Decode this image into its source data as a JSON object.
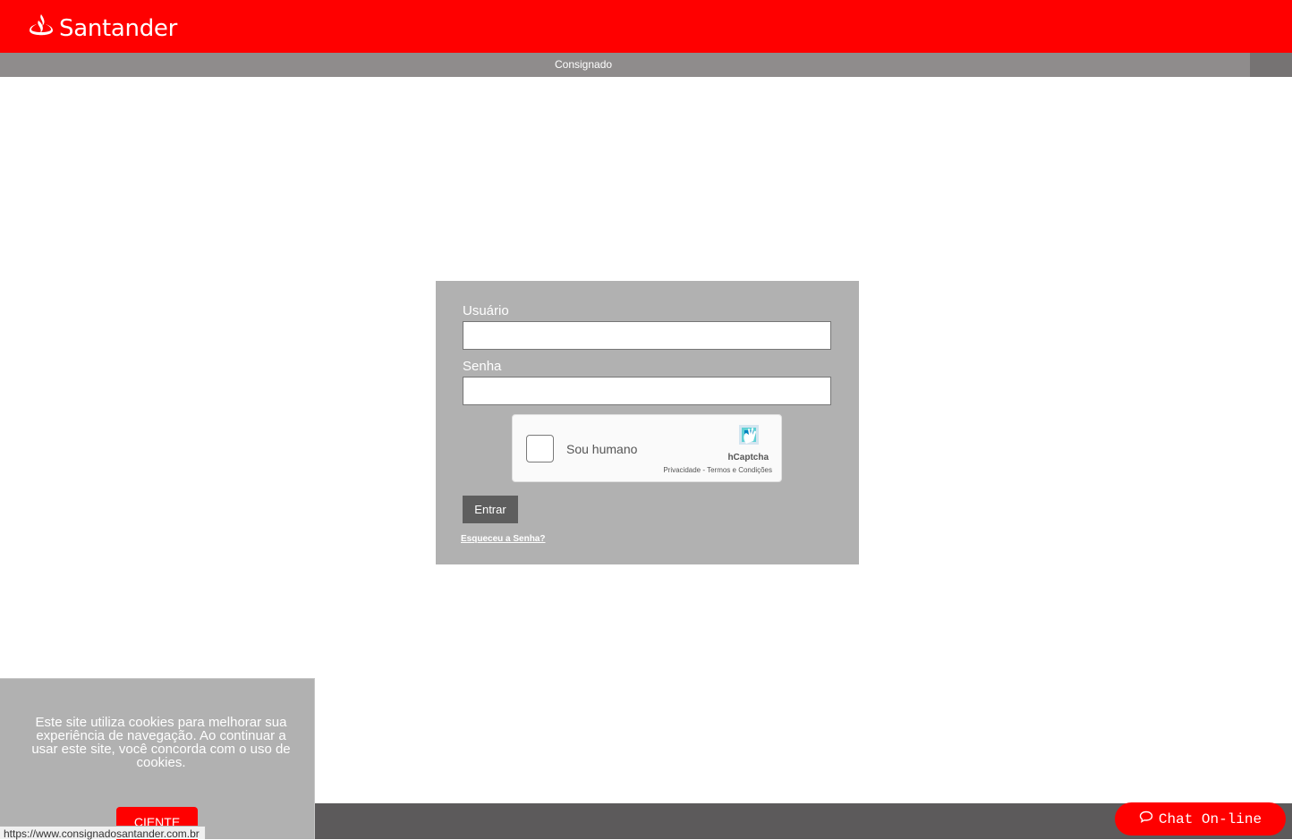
{
  "header": {
    "brand": "Santander",
    "logo_icon": "flame-icon",
    "brand_color": "#ff0000"
  },
  "subbar": {
    "title": "Consignado"
  },
  "login": {
    "username_label": "Usuário",
    "username_value": "",
    "password_label": "Senha",
    "password_value": "",
    "captcha": {
      "checkbox_label": "Sou humano",
      "brand": "hCaptcha",
      "links": "Privacidade - Termos e Condições",
      "checked": false
    },
    "submit_label": "Entrar",
    "forgot_label": "Esqueceu a Senha?"
  },
  "cookie": {
    "message": "Este site utiliza cookies para melhorar sua experiência de navegação. Ao continuar a usar este site, você concorda com o uso de cookies.",
    "accept_label": "CIENTE"
  },
  "chat": {
    "label": "Chat On-line",
    "icon": "chat-bubble-icon"
  },
  "status_bar": {
    "url": "https://www.consignadosantander.com.br"
  }
}
